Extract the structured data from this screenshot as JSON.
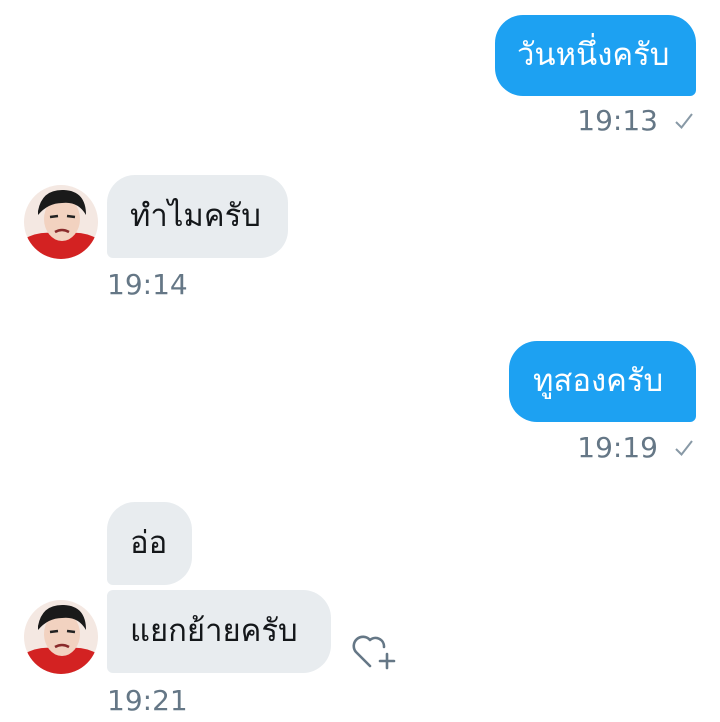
{
  "conversation": {
    "messages": [
      {
        "direction": "sent",
        "text": "วันหนึ่งครับ",
        "time": "19:13",
        "status_icon": "check-icon"
      },
      {
        "direction": "received",
        "text": "ทำไมครับ",
        "time": "19:14",
        "avatar": "avatar"
      },
      {
        "direction": "sent",
        "text": "ทูสองครับ",
        "time": "19:19",
        "status_icon": "check-icon"
      },
      {
        "direction": "received",
        "text": "อ่อ"
      },
      {
        "direction": "received",
        "text": "แยกย้ายครับ",
        "time": "19:21",
        "avatar": "avatar",
        "reaction_icon": "heart-add-icon"
      }
    ]
  },
  "colors": {
    "sent_bubble": "#1da1f2",
    "received_bubble": "#e8ecef",
    "timestamp": "#657786"
  }
}
